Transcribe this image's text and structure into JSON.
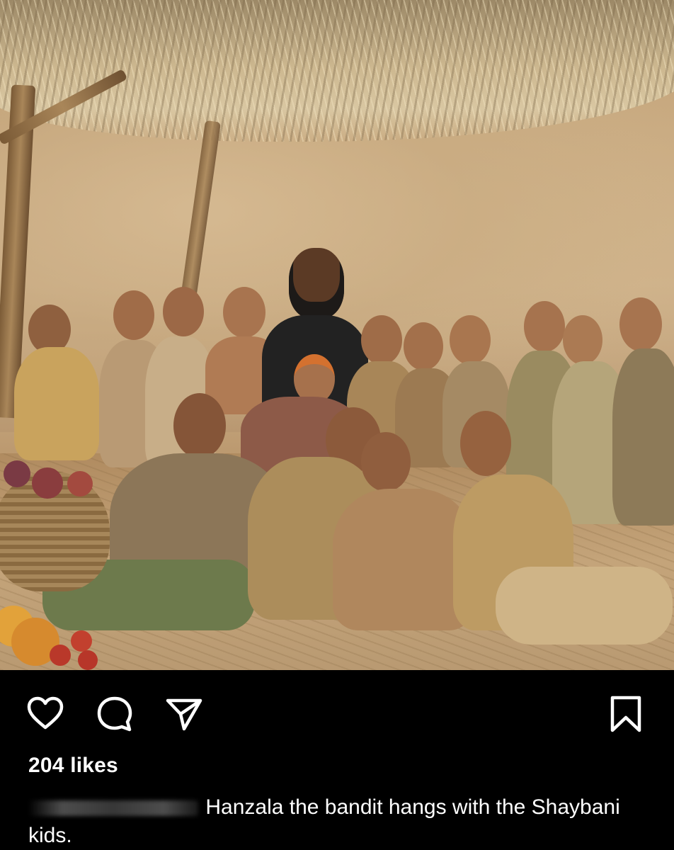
{
  "post": {
    "photo_icon": "group-photo",
    "likes_label": "204 likes",
    "caption_text": "Hanzala the bandit hangs with the Shaybani kids."
  },
  "actions": {
    "like_icon": "heart-icon",
    "comment_icon": "comment-icon",
    "share_icon": "send-icon",
    "save_icon": "bookmark-icon"
  },
  "colors": {
    "background": "#000000",
    "text": "#ffffff"
  }
}
